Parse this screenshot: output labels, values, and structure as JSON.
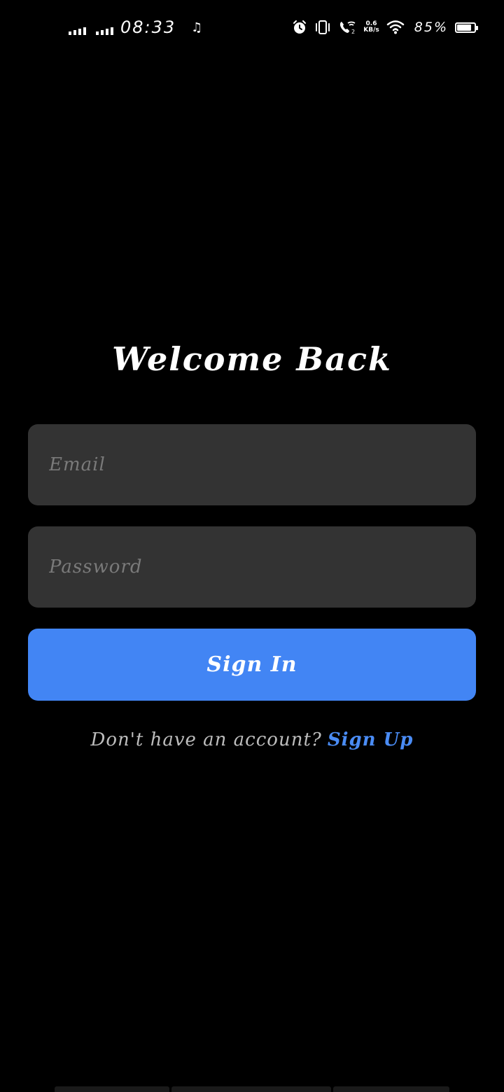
{
  "status_bar": {
    "time": "08:33",
    "net_speed_value": "0.6",
    "net_speed_unit": "KB/s",
    "battery_percent": "85%",
    "battery_level": 0.85,
    "icons": [
      "signal-icon",
      "signal-icon",
      "music-icon",
      "alarm-icon",
      "vibrate-icon",
      "wifi-calling-icon",
      "wifi-icon",
      "battery-icon"
    ]
  },
  "login": {
    "title": "Welcome Back",
    "email_placeholder": "Email",
    "email_value": "",
    "password_placeholder": "Password",
    "password_value": "",
    "signin_label": "Sign In",
    "signup_prompt": "Don't have an account?",
    "signup_link": "Sign Up"
  },
  "colors": {
    "background": "#000000",
    "field_background": "#333333",
    "accent": "#4285f4"
  }
}
